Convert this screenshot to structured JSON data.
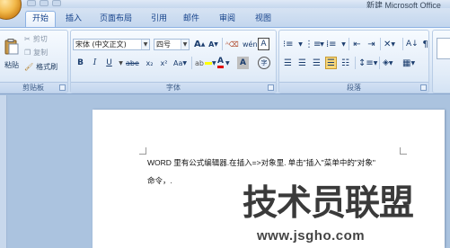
{
  "window": {
    "title": "新建 Microsoft Office"
  },
  "tabs": [
    "开始",
    "插入",
    "页面布局",
    "引用",
    "邮件",
    "审阅",
    "视图"
  ],
  "clipboard": {
    "label": "剪贴板",
    "paste": "粘贴",
    "cut": "剪切",
    "copy": "复制",
    "format_painter": "格式刷"
  },
  "font": {
    "label": "字体",
    "font_name": "宋体 (中文正文)",
    "font_size": "四号",
    "grow": "A",
    "shrink": "A",
    "bold": "B",
    "italic": "I",
    "underline": "U",
    "strike": "abe",
    "subscript": "x₂",
    "superscript": "x²",
    "change_case": "Aa",
    "font_color": "A",
    "char_shading": "A",
    "phonetic": "wén",
    "char_border": "A",
    "enclose": "字"
  },
  "paragraph": {
    "label": "段落"
  },
  "document": {
    "line1": "WORD 里有公式编辑器.在插入=>对象里. 单击\"插入\"菜单中的\"对象\"",
    "line2": "命令，."
  },
  "watermark": {
    "text": "技术员联盟",
    "url": "www.jsgho.com"
  },
  "colors": {
    "ribbon_bg": "#dfeaf7",
    "tab_text": "#15428b",
    "page": "#ffffff",
    "workspace": "#abc3df"
  }
}
